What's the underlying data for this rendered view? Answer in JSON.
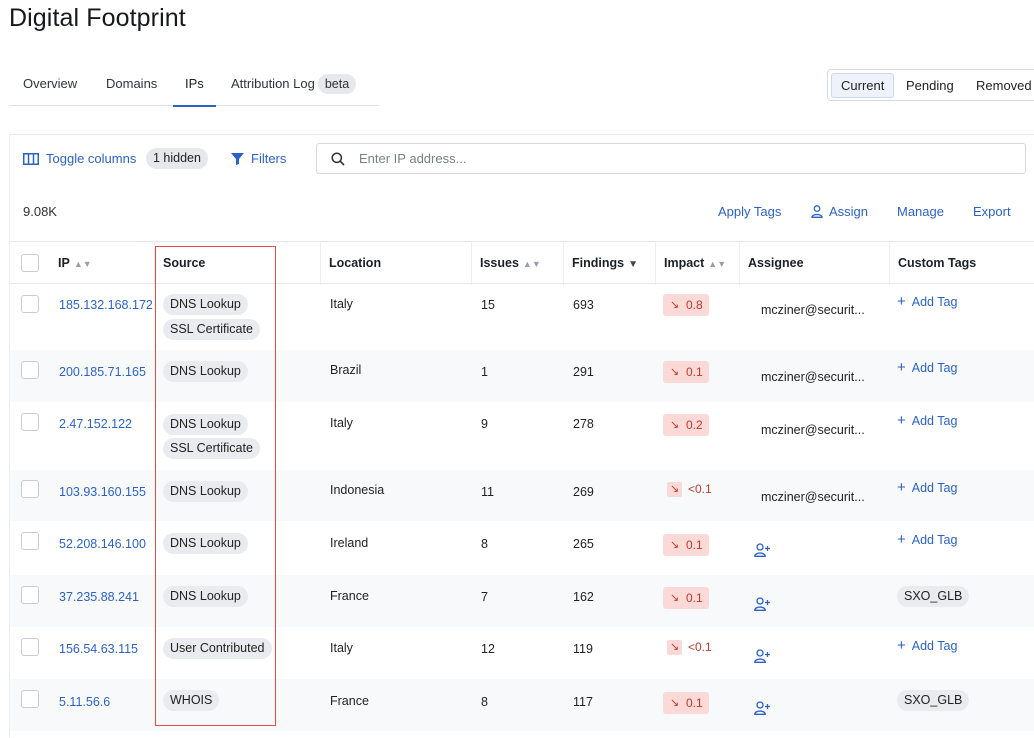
{
  "page": {
    "title": "Digital Footprint"
  },
  "tabs": [
    {
      "label": "Overview"
    },
    {
      "label": "Domains"
    },
    {
      "label": "IPs",
      "active": true
    },
    {
      "label": "Attribution Log",
      "badge": "beta"
    }
  ],
  "status_filter": {
    "options": [
      "Current",
      "Pending",
      "Removed"
    ],
    "selected": "Current"
  },
  "toolbar": {
    "toggle_columns": "Toggle columns",
    "hidden_count": "1 hidden",
    "filters": "Filters",
    "search_placeholder": "Enter IP address..."
  },
  "summary": {
    "count": "9.08K"
  },
  "actions": {
    "apply_tags": "Apply Tags",
    "assign": "Assign",
    "manage": "Manage",
    "export": "Export"
  },
  "columns": [
    "IP",
    "Source",
    "Location",
    "Issues",
    "Findings",
    "Impact",
    "Assignee",
    "Custom Tags"
  ],
  "add_tag_label": "Add Tag",
  "rows": [
    {
      "ip": "185.132.168.172",
      "sources": [
        "DNS Lookup",
        "SSL Certificate"
      ],
      "location": "Italy",
      "issues": "15",
      "findings": "693",
      "impact": "0.8",
      "assignee": "mcziner@securit...",
      "tag": ""
    },
    {
      "ip": "200.185.71.165",
      "sources": [
        "DNS Lookup"
      ],
      "location": "Brazil",
      "issues": "1",
      "findings": "291",
      "impact": "0.1",
      "assignee": "mcziner@securit...",
      "tag": ""
    },
    {
      "ip": "2.47.152.122",
      "sources": [
        "DNS Lookup",
        "SSL Certificate"
      ],
      "location": "Italy",
      "issues": "9",
      "findings": "278",
      "impact": "0.2",
      "assignee": "mcziner@securit...",
      "tag": ""
    },
    {
      "ip": "103.93.160.155",
      "sources": [
        "DNS Lookup"
      ],
      "location": "Indonesia",
      "issues": "11",
      "findings": "269",
      "impact": "<0.1",
      "assignee": "mcziner@securit...",
      "tag": ""
    },
    {
      "ip": "52.208.146.100",
      "sources": [
        "DNS Lookup"
      ],
      "location": "Ireland",
      "issues": "8",
      "findings": "265",
      "impact": "0.1",
      "assignee": "",
      "tag": ""
    },
    {
      "ip": "37.235.88.241",
      "sources": [
        "DNS Lookup"
      ],
      "location": "France",
      "issues": "7",
      "findings": "162",
      "impact": "0.1",
      "assignee": "",
      "tag": "SXO_GLB"
    },
    {
      "ip": "156.54.63.115",
      "sources": [
        "User Contributed"
      ],
      "location": "Italy",
      "issues": "12",
      "findings": "119",
      "impact": "<0.1",
      "assignee": "",
      "tag": ""
    },
    {
      "ip": "5.11.56.6",
      "sources": [
        "WHOIS"
      ],
      "location": "France",
      "issues": "8",
      "findings": "117",
      "impact": "0.1",
      "assignee": "",
      "tag": "SXO_GLB"
    }
  ],
  "colors": {
    "link": "#2b62c8",
    "impact_bg": "#fbd9d6",
    "impact_text": "#c0392b",
    "highlight": "#e74c3c"
  }
}
